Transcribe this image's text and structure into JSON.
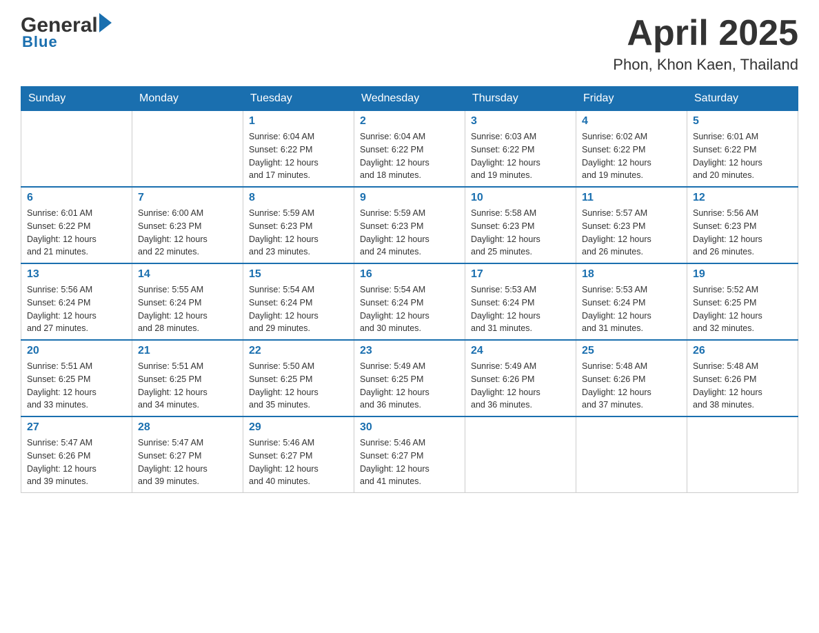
{
  "header": {
    "logo_general": "General",
    "logo_blue": "Blue",
    "title": "April 2025",
    "subtitle": "Phon, Khon Kaen, Thailand"
  },
  "weekdays": [
    "Sunday",
    "Monday",
    "Tuesday",
    "Wednesday",
    "Thursday",
    "Friday",
    "Saturday"
  ],
  "weeks": [
    [
      {
        "day": "",
        "info": ""
      },
      {
        "day": "",
        "info": ""
      },
      {
        "day": "1",
        "info": "Sunrise: 6:04 AM\nSunset: 6:22 PM\nDaylight: 12 hours\nand 17 minutes."
      },
      {
        "day": "2",
        "info": "Sunrise: 6:04 AM\nSunset: 6:22 PM\nDaylight: 12 hours\nand 18 minutes."
      },
      {
        "day": "3",
        "info": "Sunrise: 6:03 AM\nSunset: 6:22 PM\nDaylight: 12 hours\nand 19 minutes."
      },
      {
        "day": "4",
        "info": "Sunrise: 6:02 AM\nSunset: 6:22 PM\nDaylight: 12 hours\nand 19 minutes."
      },
      {
        "day": "5",
        "info": "Sunrise: 6:01 AM\nSunset: 6:22 PM\nDaylight: 12 hours\nand 20 minutes."
      }
    ],
    [
      {
        "day": "6",
        "info": "Sunrise: 6:01 AM\nSunset: 6:22 PM\nDaylight: 12 hours\nand 21 minutes."
      },
      {
        "day": "7",
        "info": "Sunrise: 6:00 AM\nSunset: 6:23 PM\nDaylight: 12 hours\nand 22 minutes."
      },
      {
        "day": "8",
        "info": "Sunrise: 5:59 AM\nSunset: 6:23 PM\nDaylight: 12 hours\nand 23 minutes."
      },
      {
        "day": "9",
        "info": "Sunrise: 5:59 AM\nSunset: 6:23 PM\nDaylight: 12 hours\nand 24 minutes."
      },
      {
        "day": "10",
        "info": "Sunrise: 5:58 AM\nSunset: 6:23 PM\nDaylight: 12 hours\nand 25 minutes."
      },
      {
        "day": "11",
        "info": "Sunrise: 5:57 AM\nSunset: 6:23 PM\nDaylight: 12 hours\nand 26 minutes."
      },
      {
        "day": "12",
        "info": "Sunrise: 5:56 AM\nSunset: 6:23 PM\nDaylight: 12 hours\nand 26 minutes."
      }
    ],
    [
      {
        "day": "13",
        "info": "Sunrise: 5:56 AM\nSunset: 6:24 PM\nDaylight: 12 hours\nand 27 minutes."
      },
      {
        "day": "14",
        "info": "Sunrise: 5:55 AM\nSunset: 6:24 PM\nDaylight: 12 hours\nand 28 minutes."
      },
      {
        "day": "15",
        "info": "Sunrise: 5:54 AM\nSunset: 6:24 PM\nDaylight: 12 hours\nand 29 minutes."
      },
      {
        "day": "16",
        "info": "Sunrise: 5:54 AM\nSunset: 6:24 PM\nDaylight: 12 hours\nand 30 minutes."
      },
      {
        "day": "17",
        "info": "Sunrise: 5:53 AM\nSunset: 6:24 PM\nDaylight: 12 hours\nand 31 minutes."
      },
      {
        "day": "18",
        "info": "Sunrise: 5:53 AM\nSunset: 6:24 PM\nDaylight: 12 hours\nand 31 minutes."
      },
      {
        "day": "19",
        "info": "Sunrise: 5:52 AM\nSunset: 6:25 PM\nDaylight: 12 hours\nand 32 minutes."
      }
    ],
    [
      {
        "day": "20",
        "info": "Sunrise: 5:51 AM\nSunset: 6:25 PM\nDaylight: 12 hours\nand 33 minutes."
      },
      {
        "day": "21",
        "info": "Sunrise: 5:51 AM\nSunset: 6:25 PM\nDaylight: 12 hours\nand 34 minutes."
      },
      {
        "day": "22",
        "info": "Sunrise: 5:50 AM\nSunset: 6:25 PM\nDaylight: 12 hours\nand 35 minutes."
      },
      {
        "day": "23",
        "info": "Sunrise: 5:49 AM\nSunset: 6:25 PM\nDaylight: 12 hours\nand 36 minutes."
      },
      {
        "day": "24",
        "info": "Sunrise: 5:49 AM\nSunset: 6:26 PM\nDaylight: 12 hours\nand 36 minutes."
      },
      {
        "day": "25",
        "info": "Sunrise: 5:48 AM\nSunset: 6:26 PM\nDaylight: 12 hours\nand 37 minutes."
      },
      {
        "day": "26",
        "info": "Sunrise: 5:48 AM\nSunset: 6:26 PM\nDaylight: 12 hours\nand 38 minutes."
      }
    ],
    [
      {
        "day": "27",
        "info": "Sunrise: 5:47 AM\nSunset: 6:26 PM\nDaylight: 12 hours\nand 39 minutes."
      },
      {
        "day": "28",
        "info": "Sunrise: 5:47 AM\nSunset: 6:27 PM\nDaylight: 12 hours\nand 39 minutes."
      },
      {
        "day": "29",
        "info": "Sunrise: 5:46 AM\nSunset: 6:27 PM\nDaylight: 12 hours\nand 40 minutes."
      },
      {
        "day": "30",
        "info": "Sunrise: 5:46 AM\nSunset: 6:27 PM\nDaylight: 12 hours\nand 41 minutes."
      },
      {
        "day": "",
        "info": ""
      },
      {
        "day": "",
        "info": ""
      },
      {
        "day": "",
        "info": ""
      }
    ]
  ]
}
